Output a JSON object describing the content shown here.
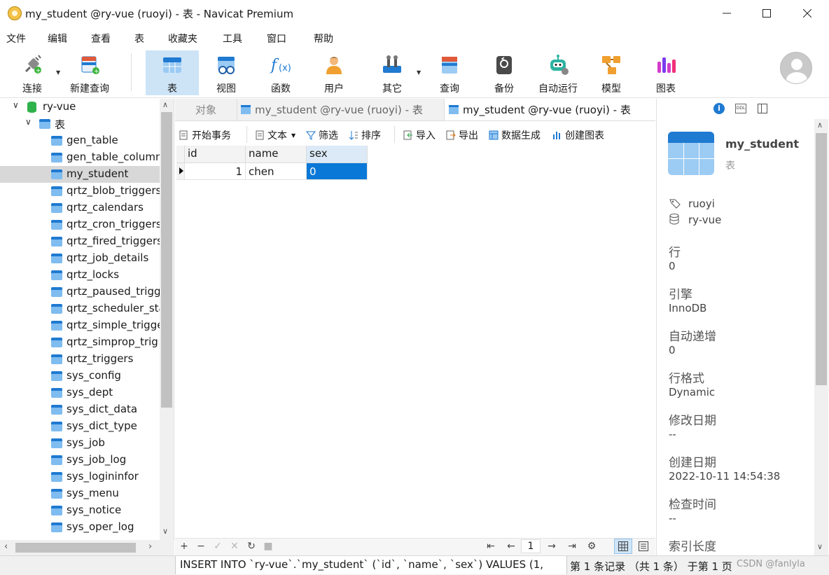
{
  "window": {
    "title": "my_student @ry-vue (ruoyi) - 表 - Navicat Premium"
  },
  "menu": [
    "文件",
    "编辑",
    "查看",
    "表",
    "收藏夹",
    "工具",
    "窗口",
    "帮助"
  ],
  "toolbar": {
    "connect": "连接",
    "new_query": "新建查询",
    "table": "表",
    "view": "视图",
    "function": "函数",
    "user": "用户",
    "other": "其它",
    "query": "查询",
    "backup": "备份",
    "auto_run": "自动运行",
    "model": "模型",
    "chart": "图表"
  },
  "tree": {
    "connection": "ry-vue",
    "group": "表",
    "tables": [
      "gen_table",
      "gen_table_column",
      "my_student",
      "qrtz_blob_triggers",
      "qrtz_calendars",
      "qrtz_cron_triggers",
      "qrtz_fired_triggers",
      "qrtz_job_details",
      "qrtz_locks",
      "qrtz_paused_trigg",
      "qrtz_scheduler_sta",
      "qrtz_simple_trigge",
      "qrtz_simprop_trig",
      "qrtz_triggers",
      "sys_config",
      "sys_dept",
      "sys_dict_data",
      "sys_dict_type",
      "sys_job",
      "sys_job_log",
      "sys_logininfor",
      "sys_menu",
      "sys_notice",
      "sys_oper_log"
    ],
    "selected": "my_student"
  },
  "tabs": {
    "objects": "对象",
    "tab1": "my_student @ry-vue (ruoyi) - 表",
    "tab2": "my_student @ry-vue (ruoyi) - 表"
  },
  "subtoolbar": {
    "begin_tx": "开始事务",
    "text": "文本",
    "filter": "筛选",
    "sort": "排序",
    "import": "导入",
    "export": "导出",
    "data_gen": "数据生成",
    "create_chart": "创建图表"
  },
  "grid": {
    "columns": [
      "id",
      "name",
      "sex"
    ],
    "rows": [
      [
        "1",
        "chen",
        "0"
      ]
    ]
  },
  "footer": {
    "page": "1"
  },
  "info": {
    "table_name": "my_student",
    "type": "表",
    "user": "ruoyi",
    "database": "ry-vue",
    "rows_label": "行",
    "rows_value": "0",
    "engine_label": "引擎",
    "engine_value": "InnoDB",
    "autoinc_label": "自动递增",
    "autoinc_value": "0",
    "rowformat_label": "行格式",
    "rowformat_value": "Dynamic",
    "modified_label": "修改日期",
    "modified_value": "--",
    "created_label": "创建日期",
    "created_value": "2022-10-11 14:54:38",
    "checked_label": "检查时间",
    "checked_value": "--",
    "indexlen_label": "索引长度"
  },
  "status": {
    "sql": "INSERT INTO `ry-vue`.`my_student` (`id`, `name`, `sex`) VALUES (1,",
    "record": "第 1 条记录 （共 1 条） 于第 1 页",
    "watermark": "CSDN @fanlyla"
  }
}
